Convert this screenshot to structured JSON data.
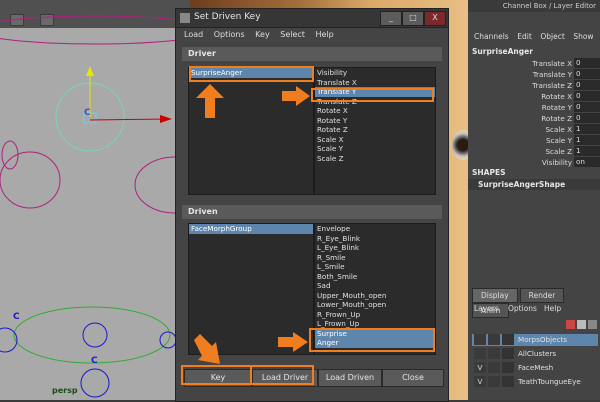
{
  "viewport": {
    "label": "persp",
    "controls": [
      "C",
      "C",
      "C"
    ]
  },
  "dialog": {
    "title": "Set Driven Key",
    "window_buttons": [
      "_",
      "□",
      "X"
    ],
    "menu": [
      "Load",
      "Options",
      "Key",
      "Select",
      "Help"
    ],
    "driver": {
      "header": "Driver",
      "objects": [
        "SurpriseAnger"
      ],
      "attributes": [
        "Visibility",
        "Translate X",
        "Translate Y",
        "Translate Z",
        "Rotate X",
        "Rotate Y",
        "Rotate Z",
        "Scale X",
        "Scale Y",
        "Scale Z"
      ],
      "selected_attribute_index": 2
    },
    "driven": {
      "header": "Driven",
      "objects": [
        "FaceMorphGroup"
      ],
      "attributes": [
        "Envelope",
        "R_Eye_Blink",
        "L_Eye_Blink",
        "R_Smile",
        "L_Smile",
        "Both_Smile",
        "Sad",
        "Upper_Mouth_open",
        "Lower_Mouth_open",
        "R_Frown_Up",
        "L_Frown_Up",
        "Surprise",
        "Anger"
      ],
      "selected_attribute_indices": [
        11,
        12
      ]
    },
    "buttons": {
      "key": "Key",
      "load_driver": "Load Driver",
      "load_driven": "Load Driven",
      "close": "Close"
    }
  },
  "channel_box": {
    "title": "Channel Box / Layer Editor",
    "menu": [
      "Channels",
      "Edit",
      "Object",
      "Show"
    ],
    "object_name": "SurpriseAnger",
    "attributes": [
      {
        "name": "Translate X",
        "value": "0"
      },
      {
        "name": "Translate Y",
        "value": "0"
      },
      {
        "name": "Translate Z",
        "value": "0"
      },
      {
        "name": "Rotate X",
        "value": "0"
      },
      {
        "name": "Rotate Y",
        "value": "0"
      },
      {
        "name": "Rotate Z",
        "value": "0"
      },
      {
        "name": "Scale X",
        "value": "1"
      },
      {
        "name": "Scale Y",
        "value": "1"
      },
      {
        "name": "Scale Z",
        "value": "1"
      },
      {
        "name": "Visibility",
        "value": "on"
      }
    ],
    "shapes_label": "SHAPES",
    "shape_name": "SurpriseAngerShape"
  },
  "layer_editor": {
    "tabs": [
      "Display",
      "Render",
      "Anim"
    ],
    "menu": [
      "Layers",
      "Options",
      "Help"
    ],
    "layers": [
      {
        "v": "",
        "name": "MorpsObjects"
      },
      {
        "v": "",
        "name": "AllClusters"
      },
      {
        "v": "V",
        "name": "FaceMesh"
      },
      {
        "v": "V",
        "name": "TeathToungueEye"
      }
    ]
  },
  "colors": {
    "highlight": "#f07e1e",
    "selection": "#5e86ad"
  }
}
